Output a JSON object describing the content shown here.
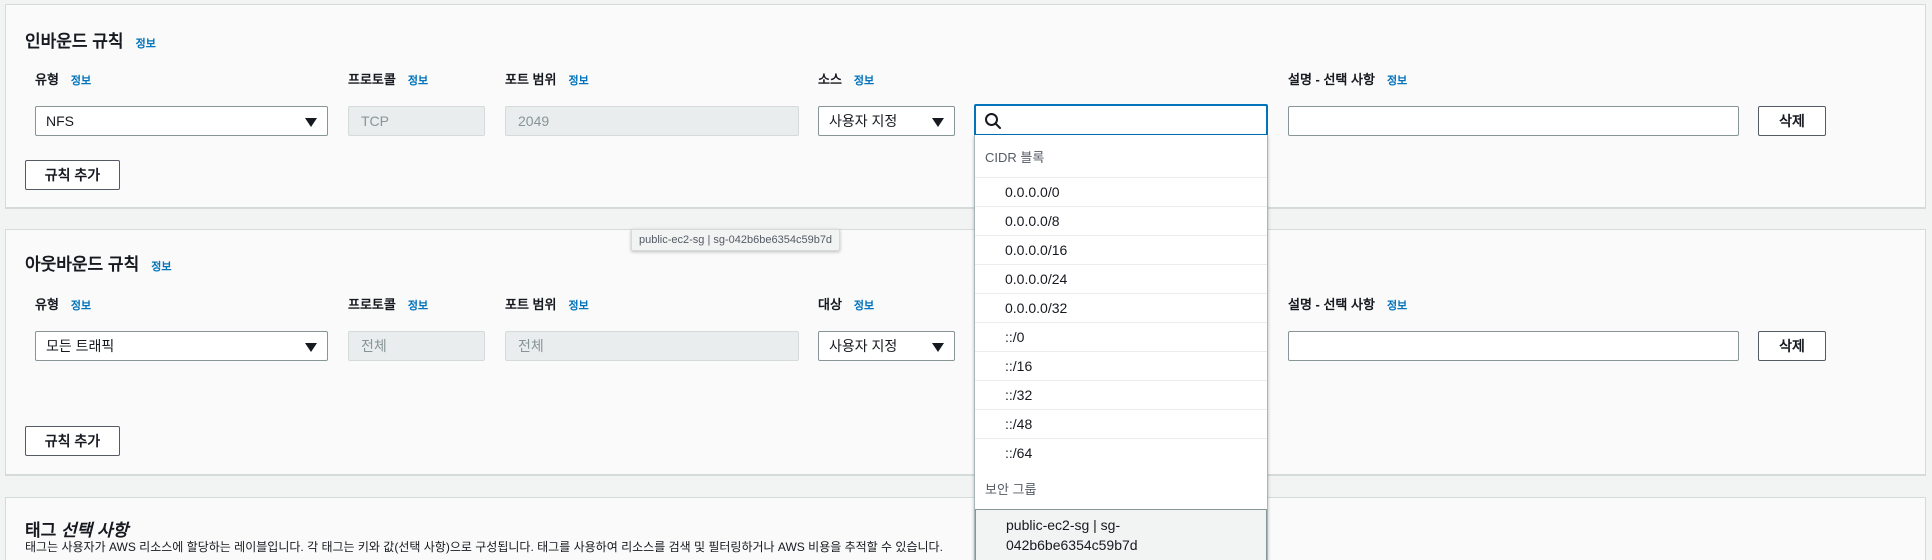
{
  "info_link": "정보",
  "inbound": {
    "title": "인바운드 규칙",
    "col_type": "유형",
    "col_protocol": "프로토콜",
    "col_port": "포트 범위",
    "col_source": "소스",
    "col_desc": "설명 - 선택 사항",
    "type_value": "NFS",
    "protocol_value": "TCP",
    "port_value": "2049",
    "source_mode": "사용자 지정",
    "search_value": "",
    "desc_value": "",
    "delete_label": "삭제",
    "add_rule_label": "규칙 추가"
  },
  "outbound": {
    "title": "아웃바운드 규칙",
    "col_type": "유형",
    "col_protocol": "프로토콜",
    "col_port": "포트 범위",
    "col_dest": "대상",
    "col_desc": "설명 - 선택 사항",
    "type_value": "모든 트래픽",
    "protocol_value": "전체",
    "port_value": "전체",
    "dest_mode": "사용자 지정",
    "desc_value": "",
    "delete_label": "삭제",
    "add_rule_label": "규칙 추가"
  },
  "tags": {
    "title": "태그",
    "title_optional": "선택 사항",
    "description": "태그는 사용자가 AWS 리소스에 할당하는 레이블입니다. 각 태그는 키와 값(선택 사항)으로 구성됩니다. 태그를 사용하여 리소스를 검색 및 필터링하거나 AWS 비용을 추적할 수 있습니다."
  },
  "dropdown": {
    "cidr_group_label": "CIDR 블록",
    "cidr_items": [
      "0.0.0.0/0",
      "0.0.0.0/8",
      "0.0.0.0/16",
      "0.0.0.0/24",
      "0.0.0.0/32",
      "::/0",
      "::/16",
      "::/32",
      "::/48",
      "::/64"
    ],
    "sg_group_label": "보안 그룹",
    "sg_item_line1": "public-ec2-sg | sg-",
    "sg_item_line2": "042b6be6354c59b7d"
  },
  "tooltip": "public-ec2-sg | sg-042b6be6354c59b7d",
  "icons": {
    "search": "search-icon",
    "caret": "caret-down-icon"
  },
  "colors": {
    "link": "#0073bb",
    "focus": "#0073bb"
  }
}
